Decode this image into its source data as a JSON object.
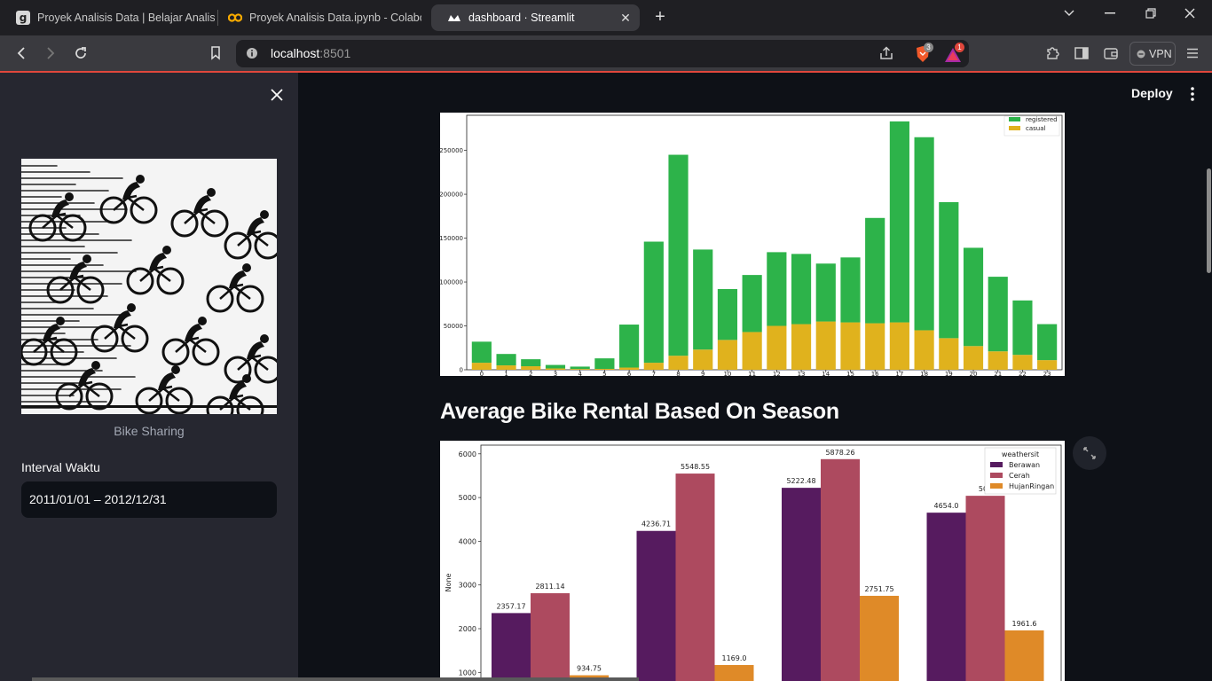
{
  "browser": {
    "tabs": [
      {
        "title": "Proyek Analisis Data | Belajar Analisis",
        "icon": "dicoding-icon"
      },
      {
        "title": "Proyek Analisis Data.ipynb - Colaboratory",
        "icon": "colab-icon"
      },
      {
        "title": "dashboard · Streamlit",
        "icon": "streamlit-icon",
        "active": true
      }
    ],
    "url_host": "localhost",
    "url_port": ":8501",
    "brave_badge": "3",
    "rewards_badge": "1",
    "vpn_label": "VPN"
  },
  "sidebar": {
    "image_caption": "Bike Sharing",
    "interval_label": "Interval Waktu",
    "date_value": "2011/01/01 – 2012/12/31"
  },
  "header": {
    "deploy_label": "Deploy"
  },
  "main": {
    "season_title": "Average Bike Rental Based On Season"
  },
  "colors": {
    "registered": "#2db34a",
    "casual": "#e0b21d",
    "berawan": "#561b5f",
    "cerah": "#ad4a5f",
    "hujan": "#df8a28",
    "accent": "#e0473c"
  },
  "chart_data": [
    {
      "type": "bar",
      "stacked": true,
      "categories": [
        "0",
        "1",
        "2",
        "3",
        "4",
        "5",
        "6",
        "7",
        "8",
        "9",
        "10",
        "11",
        "12",
        "13",
        "14",
        "15",
        "16",
        "17",
        "18",
        "19",
        "20",
        "21",
        "22",
        "23"
      ],
      "series": [
        {
          "name": "registered",
          "values": [
            24000,
            13000,
            8000,
            4000,
            2700,
            12000,
            49000,
            138000,
            229000,
            114000,
            58000,
            65000,
            84000,
            80000,
            66000,
            74000,
            120000,
            229000,
            220000,
            155000,
            112000,
            85000,
            62000,
            41000
          ]
        },
        {
          "name": "casual",
          "values": [
            8000,
            5000,
            4000,
            1500,
            900,
            1000,
            2500,
            8000,
            16000,
            23000,
            34000,
            43000,
            50000,
            52000,
            55000,
            54000,
            53000,
            54000,
            45000,
            36000,
            27000,
            21000,
            17000,
            11000
          ]
        }
      ],
      "yticks": [
        "0",
        "50000",
        "100000",
        "150000",
        "200000",
        "250000"
      ],
      "ylim": [
        0,
        290000
      ],
      "legend": "top-right"
    },
    {
      "type": "bar",
      "title": "Average Bike Rental Based On Season",
      "ylabel": "None",
      "legend_title": "weathersit",
      "legend": "top-right",
      "series": [
        {
          "name": "Berawan",
          "values": [
            2357.17,
            4236.71,
            5222.48,
            4654.0
          ],
          "labels": [
            "2357.17",
            "4236.71",
            "5222.48",
            "4654.0"
          ]
        },
        {
          "name": "Cerah",
          "values": [
            2811.14,
            5548.55,
            5878.26,
            5040
          ],
          "labels": [
            "2811.14",
            "5548.55",
            "5878.26",
            "504"
          ]
        },
        {
          "name": "HujanRingan",
          "values": [
            934.75,
            1169.0,
            2751.75,
            1961.6
          ],
          "labels": [
            "934.75",
            "1169.0",
            "2751.75",
            "1961.6"
          ]
        }
      ],
      "yticks": [
        "1000",
        "2000",
        "3000",
        "4000",
        "5000",
        "6000"
      ],
      "ylim": [
        0,
        6200
      ]
    }
  ]
}
